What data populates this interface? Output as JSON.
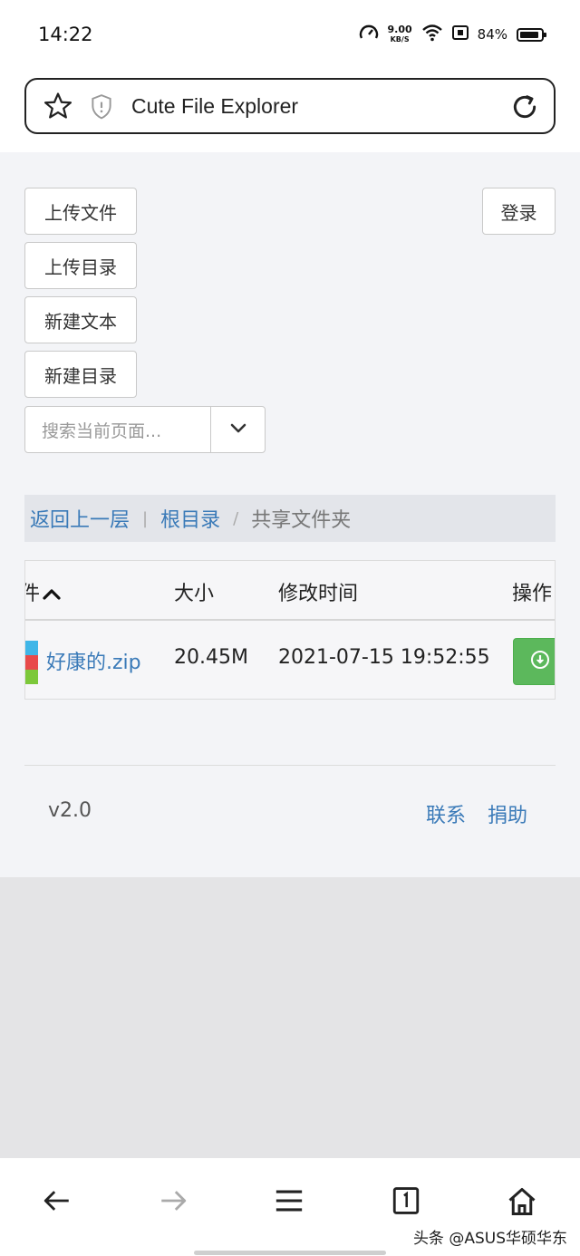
{
  "status_bar": {
    "time": "14:22",
    "net_speed_value": "9.00",
    "net_speed_unit": "KB/S",
    "battery_percent": "84%",
    "battery_level": 0.84
  },
  "address_bar": {
    "title": "Cute File Explorer"
  },
  "toolbar": {
    "upload_file": "上传文件",
    "upload_dir": "上传目录",
    "new_text": "新建文本",
    "new_dir": "新建目录",
    "login": "登录"
  },
  "search": {
    "placeholder": "搜索当前页面..."
  },
  "breadcrumb": {
    "back": "返回上一层",
    "sep1": "|",
    "root": "根目录",
    "sep2": "/",
    "current": "共享文件夹"
  },
  "table": {
    "headers": {
      "name": "件",
      "size": "大小",
      "modified": "修改时间",
      "actions": "操作"
    },
    "rows": [
      {
        "name": "好康的.zip",
        "size": "20.45M",
        "modified": "2021-07-15 19:52:55"
      }
    ]
  },
  "footer": {
    "version": "v2.0",
    "contact": "联系",
    "donate": "捐助"
  },
  "watermark": "头条 @ASUS华硕华东",
  "colors": {
    "link": "#3a7ab8",
    "download_button": "#5cb85c",
    "page_background": "#f3f4f7"
  }
}
